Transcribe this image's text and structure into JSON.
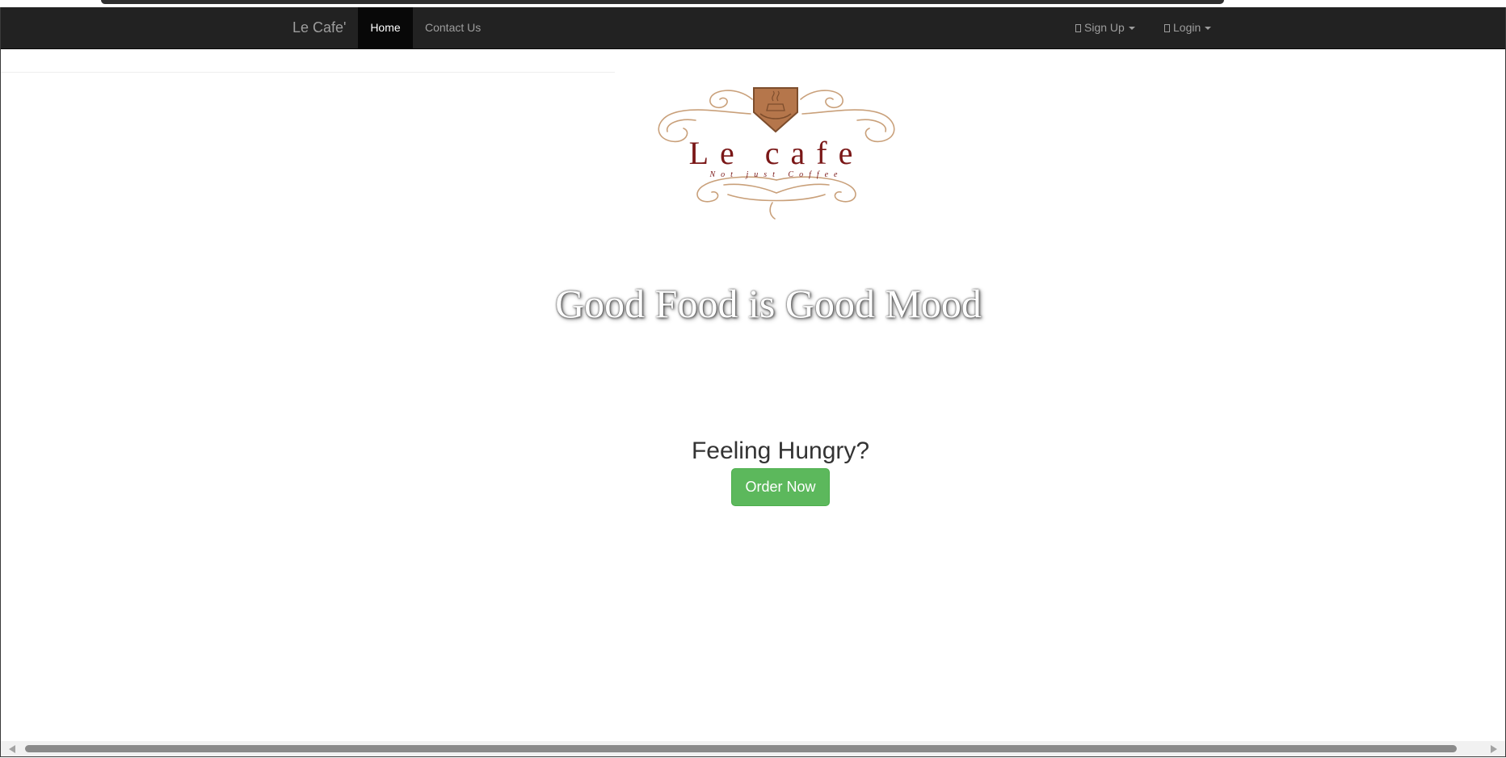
{
  "navbar": {
    "brand": "Le Cafe'",
    "links": [
      {
        "label": "Home",
        "active": true
      },
      {
        "label": "Contact Us",
        "active": false
      }
    ],
    "right": [
      {
        "label": "Sign Up",
        "icon": "user-icon"
      },
      {
        "label": "Login",
        "icon": "login-icon"
      }
    ]
  },
  "logo": {
    "name": "Le cafe",
    "slogan": "Not just Coffee",
    "colors": {
      "text": "#7a1717",
      "ornament": "#c9a07a",
      "shield": "#b5764b"
    }
  },
  "hero": {
    "tagline": "Good Food is Good Mood"
  },
  "cta": {
    "heading": "Feeling Hungry?",
    "button_label": "Order Now",
    "button_color": "#5cb85c"
  }
}
